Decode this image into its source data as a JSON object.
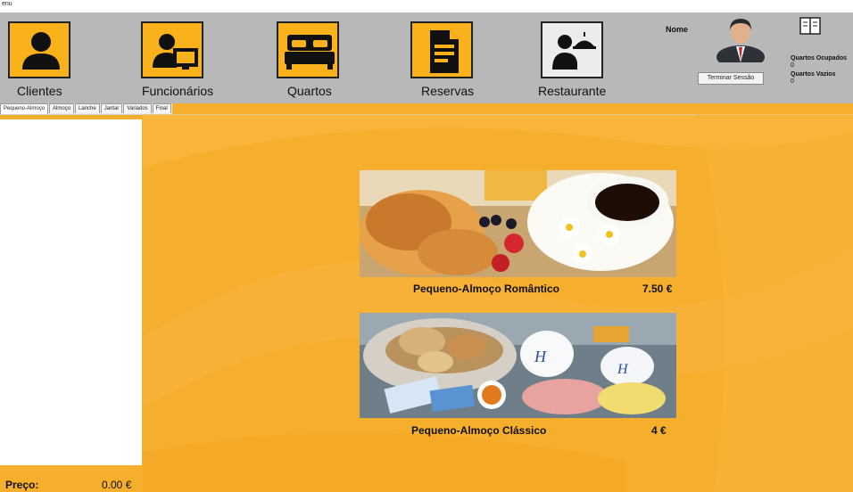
{
  "window": {
    "title": "enu"
  },
  "toolbar": {
    "buttons": [
      {
        "label": "Clientes",
        "icon": "person-icon"
      },
      {
        "label": "Funcionários",
        "icon": "employee-computer-icon"
      },
      {
        "label": "Quartos",
        "icon": "bed-icon"
      },
      {
        "label": "Reservas",
        "icon": "document-icon"
      },
      {
        "label": "Restaurante",
        "icon": "waiter-icon"
      }
    ],
    "accent": "#f9b11c"
  },
  "user": {
    "name_label": "Nome",
    "logout_label": "Terminar Sessão"
  },
  "stats": {
    "occupied_label": "Quartos Ocupados",
    "occupied_value": "0",
    "free_label": "Quartos Vazios",
    "free_value": "0"
  },
  "tabs": [
    "Pequeno-Almoço",
    "Almoço",
    "Lanche",
    "Jantar",
    "Variados",
    "Final"
  ],
  "menu_items": [
    {
      "name": "Pequeno-Almoço Romântico",
      "price": "7.50 €"
    },
    {
      "name": "Pequeno-Almoço Clássico",
      "price": "4 €"
    }
  ],
  "footer": {
    "price_label": "Preço:",
    "price_value": "0.00 €"
  },
  "colors": {
    "background": "#f6ae2d",
    "toolbar": "#b8b8b8"
  }
}
